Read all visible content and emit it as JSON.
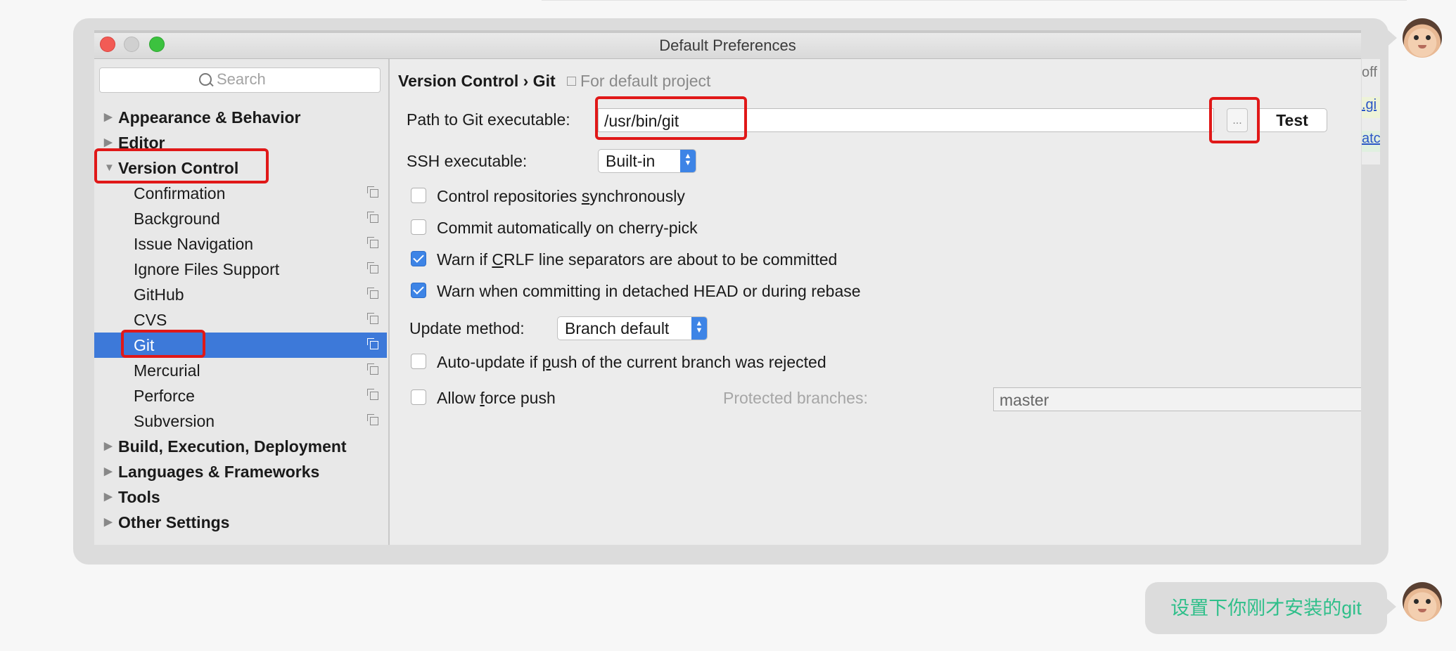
{
  "window": {
    "title": "Default Preferences"
  },
  "sidebar": {
    "search_placeholder": "Search",
    "top_items": [
      {
        "label": "Appearance & Behavior",
        "arrow": "▶"
      },
      {
        "label": "Editor",
        "arrow": "▶"
      },
      {
        "label": "Version Control",
        "arrow": "▼"
      },
      {
        "label": "Build, Execution, Deployment",
        "arrow": "▶"
      },
      {
        "label": "Languages & Frameworks",
        "arrow": "▶"
      },
      {
        "label": "Tools",
        "arrow": "▶"
      },
      {
        "label": "Other Settings",
        "arrow": "▶"
      }
    ],
    "vc_children": [
      {
        "label": "Confirmation"
      },
      {
        "label": "Background"
      },
      {
        "label": "Issue Navigation"
      },
      {
        "label": "Ignore Files Support"
      },
      {
        "label": "GitHub"
      },
      {
        "label": "CVS"
      },
      {
        "label": "Git",
        "selected": true
      },
      {
        "label": "Mercurial"
      },
      {
        "label": "Perforce"
      },
      {
        "label": "Subversion"
      }
    ]
  },
  "content": {
    "breadcrumb": "Version Control › Git",
    "scope_label": "For default project",
    "path_label": "Path to Git executable:",
    "path_value": "/usr/bin/git",
    "browse_label": "...",
    "test_label": "Test",
    "ssh_label": "SSH executable:",
    "ssh_value": "Built-in",
    "checkbox_control_sync": {
      "pre": "Control repositories ",
      "u": "s",
      "post": "ynchronously",
      "checked": false
    },
    "checkbox_cherry_pick": {
      "label": "Commit automatically on cherry-pick",
      "checked": false
    },
    "checkbox_crlf": {
      "pre": "Warn if ",
      "u": "C",
      "post": "RLF line separators are about to be committed",
      "checked": true
    },
    "checkbox_detached": {
      "label": "Warn when committing in detached HEAD or during rebase",
      "checked": true
    },
    "update_method_label": "Update method:",
    "update_method_value": "Branch default",
    "checkbox_auto_update": {
      "pre": "Auto-update if ",
      "u": "p",
      "post": "ush of the current branch was rejected",
      "checked": false
    },
    "checkbox_force_push": {
      "pre": "Allow ",
      "u": "f",
      "post": "orce push",
      "checked": false
    },
    "protected_label": "Protected branches:",
    "protected_value": "master",
    "protected_browse": "..."
  },
  "edge_snippet": {
    "t1": "off",
    "t2": ".gi",
    "t3": "atc"
  },
  "chat": {
    "message": "设置下你刚才安装的git"
  },
  "colors": {
    "selection": "#3d79d9",
    "highlight_box": "#e01818",
    "message_text": "#2fbf8a",
    "accent": "#3d84e6"
  },
  "icons": {
    "avatar": "baby-avatar",
    "copy": "copy-icon",
    "search": "search-icon"
  }
}
